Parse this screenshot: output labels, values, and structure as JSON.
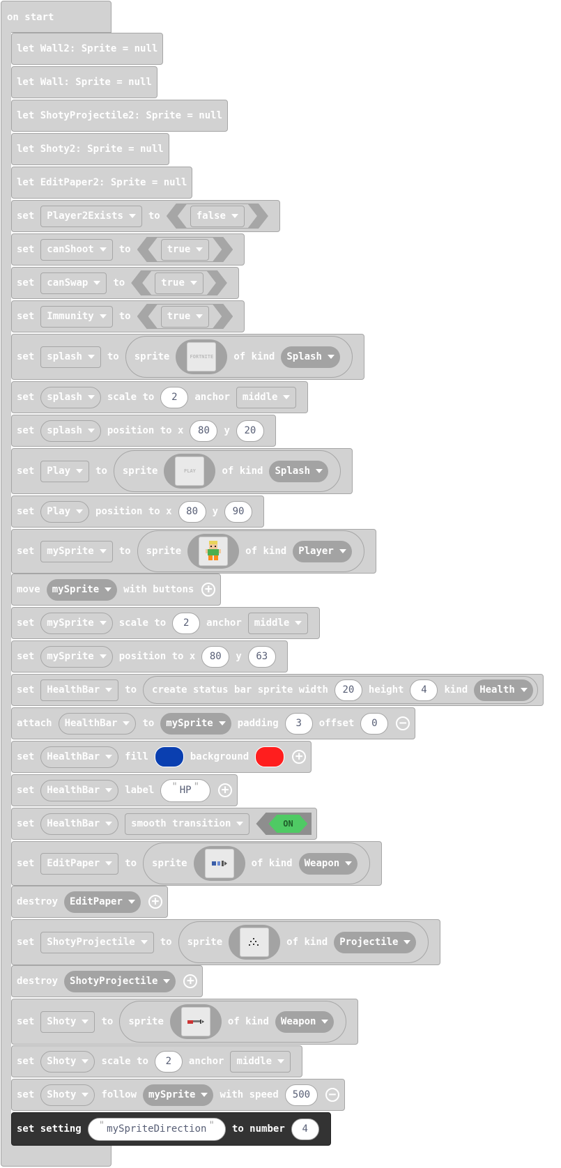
{
  "hat": {
    "label": "on start"
  },
  "rows": {
    "r1": {
      "text": "let Wall2: Sprite = null"
    },
    "r2": {
      "text": "let Wall: Sprite = null"
    },
    "r3": {
      "text": "let ShotyProjectile2: Sprite = null"
    },
    "r4": {
      "text": "let Shoty2: Sprite = null"
    },
    "r5": {
      "text": "let EditPaper2: Sprite = null"
    },
    "r6": {
      "kw1": "set",
      "var": "Player2Exists",
      "kw2": "to",
      "val": "false"
    },
    "r7": {
      "kw1": "set",
      "var": "canShoot",
      "kw2": "to",
      "val": "true"
    },
    "r8": {
      "kw1": "set",
      "var": "canSwap",
      "kw2": "to",
      "val": "true"
    },
    "r9": {
      "kw1": "set",
      "var": "Immunity",
      "kw2": "to",
      "val": "true"
    },
    "r10": {
      "kw1": "set",
      "var": "splash",
      "kw2": "to",
      "sprite": "sprite",
      "kindlabel": "of kind",
      "kind": "Splash",
      "thumb": "FORTNITE"
    },
    "r11": {
      "kw1": "set",
      "var": "splash",
      "kw2": "scale to",
      "num": "2",
      "kw3": "anchor",
      "anchor": "middle"
    },
    "r12": {
      "kw1": "set",
      "var": "splash",
      "kw2": "position to x",
      "x": "80",
      "ylabel": "y",
      "y": "20"
    },
    "r13": {
      "kw1": "set",
      "var": "Play",
      "kw2": "to",
      "sprite": "sprite",
      "kindlabel": "of kind",
      "kind": "Splash",
      "thumb": "PLAY"
    },
    "r14": {
      "kw1": "set",
      "var": "Play",
      "kw2": "position to x",
      "x": "80",
      "ylabel": "y",
      "y": "90"
    },
    "r15": {
      "kw1": "set",
      "var": "mySprite",
      "kw2": "to",
      "sprite": "sprite",
      "kindlabel": "of kind",
      "kind": "Player"
    },
    "r16": {
      "kw1": "move",
      "var": "mySprite",
      "kw2": "with buttons"
    },
    "r17": {
      "kw1": "set",
      "var": "mySprite",
      "kw2": "scale to",
      "num": "2",
      "kw3": "anchor",
      "anchor": "middle"
    },
    "r18": {
      "kw1": "set",
      "var": "mySprite",
      "kw2": "position to x",
      "x": "80",
      "ylabel": "y",
      "y": "63"
    },
    "r19": {
      "kw1": "set",
      "var": "HealthBar",
      "kw2": "to",
      "create": "create status bar sprite width",
      "width": "20",
      "hlabel": "height",
      "height": "4",
      "kindlabel": "kind",
      "kind": "Health"
    },
    "r20": {
      "kw1": "attach",
      "var": "HealthBar",
      "kw2": "to",
      "target": "mySprite",
      "plabel": "padding",
      "padding": "3",
      "olabel": "offset",
      "offset": "0"
    },
    "r21": {
      "kw1": "set",
      "var": "HealthBar",
      "kw2": "fill",
      "kw3": "background",
      "fill_color": "#0a3fb0",
      "bg_color": "#ff1e1e"
    },
    "r22": {
      "kw1": "set",
      "var": "HealthBar",
      "kw2": "label",
      "label": "HP"
    },
    "r23": {
      "kw1": "set",
      "var": "HealthBar",
      "opt": "smooth transition",
      "toggle": "ON"
    },
    "r24": {
      "kw1": "set",
      "var": "EditPaper",
      "kw2": "to",
      "sprite": "sprite",
      "kindlabel": "of kind",
      "kind": "Weapon"
    },
    "r25": {
      "kw1": "destroy",
      "var": "EditPaper"
    },
    "r26": {
      "kw1": "set",
      "var": "ShotyProjectile",
      "kw2": "to",
      "sprite": "sprite",
      "kindlabel": "of kind",
      "kind": "Projectile"
    },
    "r27": {
      "kw1": "destroy",
      "var": "ShotyProjectile"
    },
    "r28": {
      "kw1": "set",
      "var": "Shoty",
      "kw2": "to",
      "sprite": "sprite",
      "kindlabel": "of kind",
      "kind": "Weapon"
    },
    "r29": {
      "kw1": "set",
      "var": "Shoty",
      "kw2": "scale to",
      "num": "2",
      "kw3": "anchor",
      "anchor": "middle"
    },
    "r30": {
      "kw1": "set",
      "var": "Shoty",
      "kw2": "follow",
      "target": "mySprite",
      "kw3": "with speed",
      "speed": "500"
    },
    "r31": {
      "kw1": "set setting",
      "key": "mySpriteDirection",
      "kw2": "to number",
      "num": "4"
    }
  }
}
